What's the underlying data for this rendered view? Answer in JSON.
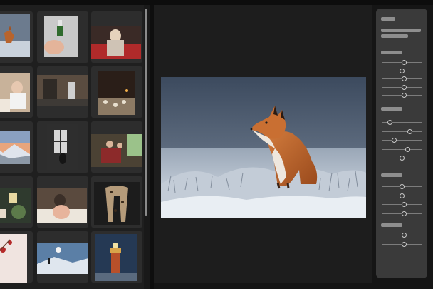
{
  "photo_grid": {
    "thumbnails": [
      {
        "subject": "fox-in-snow"
      },
      {
        "subject": "hand-holding-nail-polish"
      },
      {
        "subject": "woman-on-red-couch"
      },
      {
        "subject": "family-dinner"
      },
      {
        "subject": "kitchen-interior"
      },
      {
        "subject": "candle-table-setting"
      },
      {
        "subject": "snowy-mountains-sunset"
      },
      {
        "subject": "window-silhouette"
      },
      {
        "subject": "group-of-people-outdoors"
      },
      {
        "subject": "tea-and-snacks"
      },
      {
        "subject": "woman-in-blanket"
      },
      {
        "subject": "leopard-scarf"
      },
      {
        "subject": "red-berries"
      },
      {
        "subject": "hiker-in-snow"
      },
      {
        "subject": "lighthouse-at-night"
      }
    ]
  },
  "viewer": {
    "photo_subject": "red-fox-in-frosty-field"
  },
  "adjustments_panel": {
    "sections": [
      {
        "sliders": [
          0.55,
          0.5,
          0.55,
          0.55,
          0.55
        ]
      },
      {
        "sliders": [
          0.2,
          0.7,
          0.3,
          0.65,
          0.5
        ]
      },
      {
        "sliders": [
          0.5,
          0.5,
          0.55,
          0.55
        ]
      },
      {
        "sliders": [
          0.55,
          0.55
        ]
      }
    ]
  },
  "colors": {
    "background": "#151515",
    "panel": "#3a3a3a",
    "accent_knob": "#c9c9c9"
  }
}
